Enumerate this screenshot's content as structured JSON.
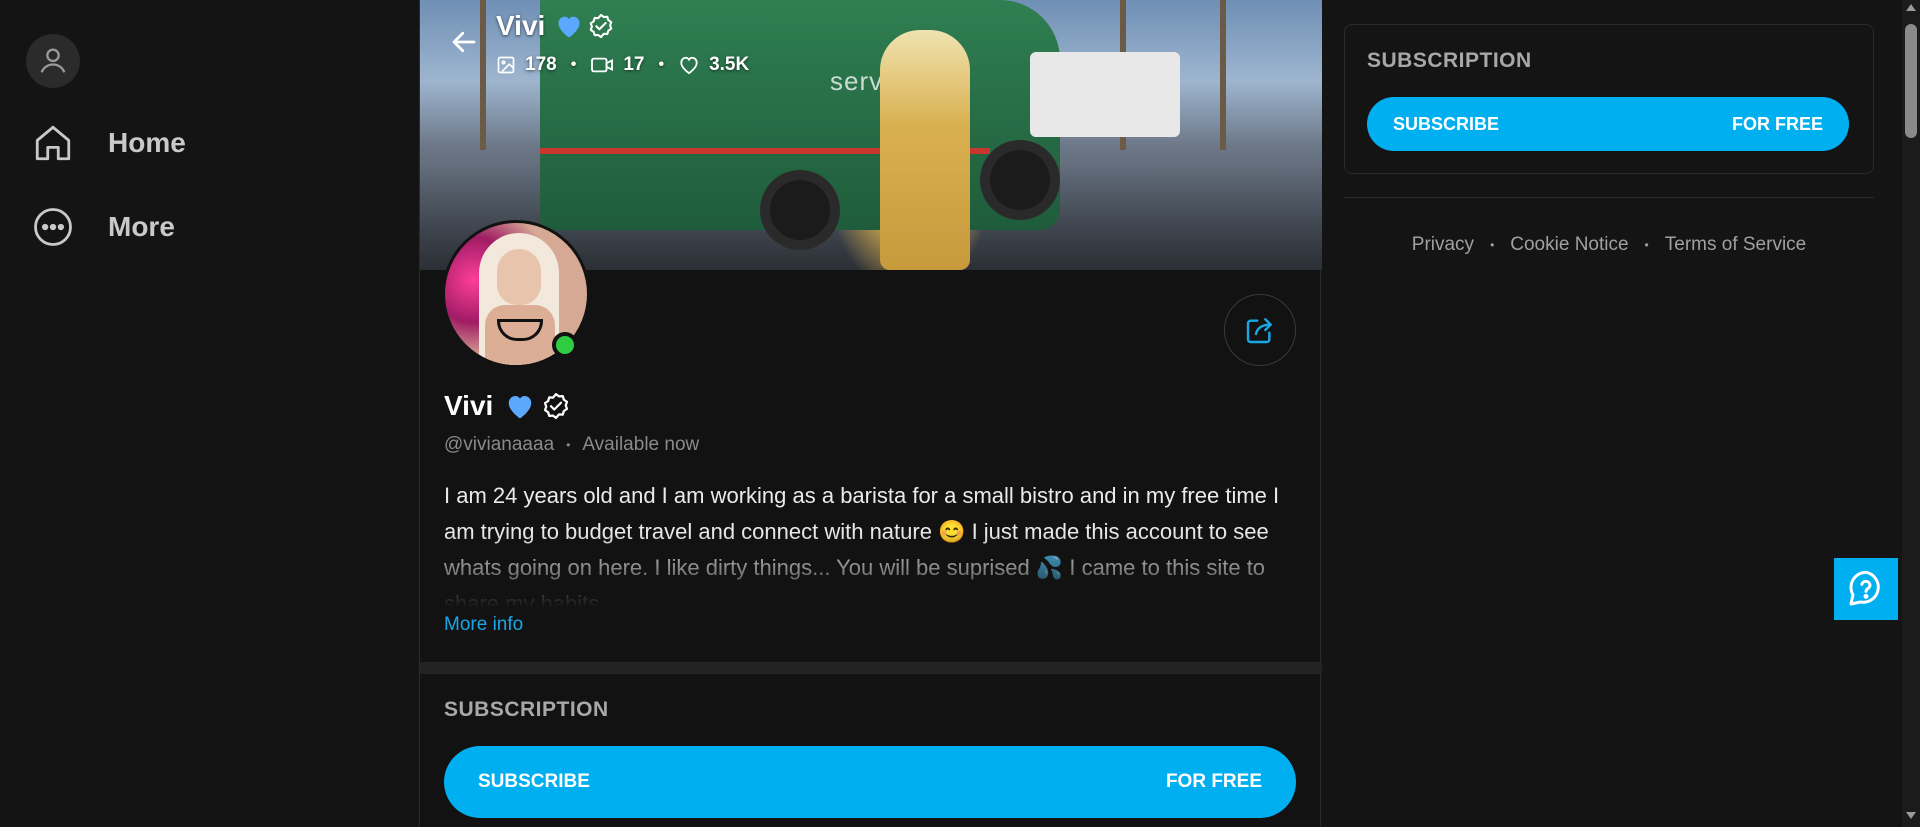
{
  "nav": {
    "items": [
      {
        "label": "Home",
        "icon": "home-icon"
      },
      {
        "label": "More",
        "icon": "more-icon"
      }
    ]
  },
  "profile": {
    "name": "Vivi",
    "handle": "@vivianaaaa",
    "status": "Available now",
    "stats": {
      "photos": "178",
      "videos": "17",
      "likes": "3.5K"
    },
    "bio": "I am 24 years old and I am working as a barista for a small bistro and in my free time I am trying to budget travel and connect with nature 😊 I just made this account to see whats going on here. I like dirty things... You will be suprised 💦 I came to this site to share my habits...",
    "more_info": "More info",
    "online": true
  },
  "cover": {
    "van_text": "servier"
  },
  "subscription": {
    "title": "SUBSCRIPTION",
    "button_label": "SUBSCRIBE",
    "price_label": "FOR FREE"
  },
  "sidebar_right": {
    "subscription_title": "SUBSCRIPTION",
    "button_label": "SUBSCRIBE",
    "price_label": "FOR FREE",
    "footer_links": [
      "Privacy",
      "Cookie Notice",
      "Terms of Service"
    ]
  },
  "colors": {
    "accent": "#00aff0",
    "link": "#1aa7e6",
    "online": "#2ecc40",
    "background": "#141414",
    "heart_badge": "#5aa9ff"
  }
}
